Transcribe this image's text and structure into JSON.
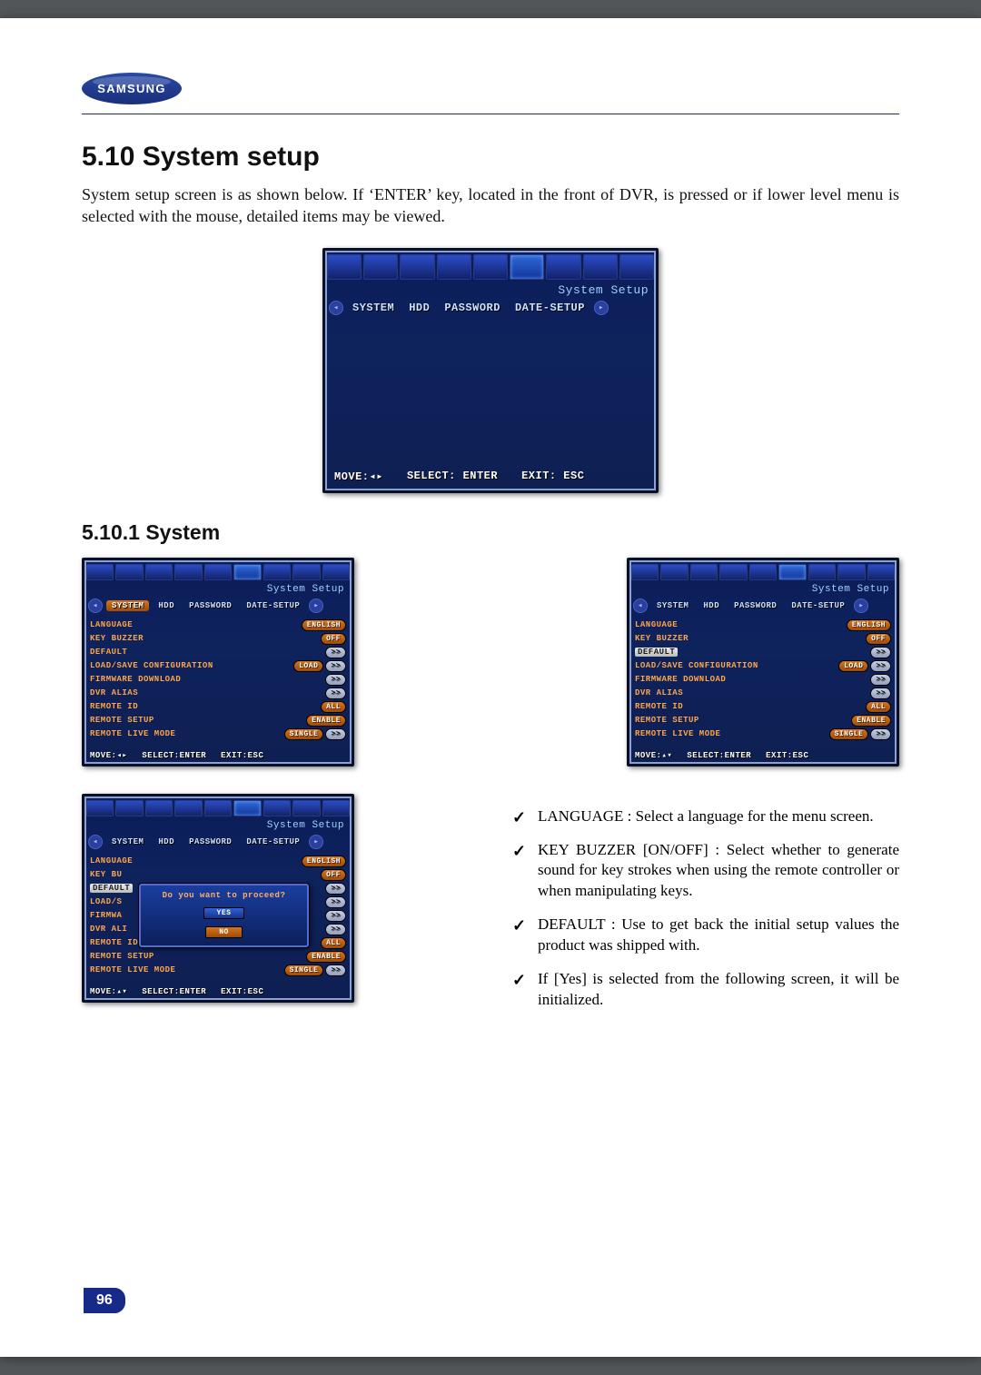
{
  "logo_text": "SAMSUNG",
  "section_heading": "5.10 System setup",
  "section_intro": "System setup screen is as shown below. If ‘ENTER’ key, located in the front of DVR, is pressed or if lower level menu is selected with the mouse, detailed items may be viewed.",
  "subsection_heading": "5.10.1 System",
  "page_number": "96",
  "screen_title": "System Setup",
  "tabs": [
    "SYSTEM",
    "HDD",
    "PASSWORD",
    "DATE-SETUP"
  ],
  "footer_move_lr": "MOVE:◂▸",
  "footer_move_ud": "MOVE:▴▾",
  "footer_select": "SELECT: ENTER",
  "footer_select_tight": "SELECT:ENTER",
  "footer_exit": "EXIT: ESC",
  "footer_exit_tight": "EXIT:ESC",
  "rows": {
    "language": {
      "label": "LANGUAGE",
      "value": "ENGLISH"
    },
    "key_buzzer": {
      "label": "KEY BUZZER",
      "value": "OFF"
    },
    "default": {
      "label": "DEFAULT",
      "value": ">>"
    },
    "load_save": {
      "label": "LOAD/SAVE CONFIGURATION",
      "value": "LOAD",
      "arrow": ">>"
    },
    "firmware": {
      "label": "FIRMWARE DOWNLOAD",
      "value": ">>"
    },
    "dvr_alias": {
      "label": "DVR ALIAS",
      "value": ">>"
    },
    "remote_id": {
      "label": "REMOTE ID",
      "value": "ALL"
    },
    "remote_setup": {
      "label": "REMOTE SETUP",
      "value": "ENABLE"
    },
    "remote_live": {
      "label": "REMOTE LIVE MODE",
      "value": "SINGLE",
      "arrow": ">>"
    }
  },
  "dialog_prompt": "Do you want to proceed?",
  "dialog_yes": "YES",
  "dialog_no": "NO",
  "trunc": {
    "load_s": "LOAD/S",
    "firmwa": "FIRMWA",
    "dvr_al": "DVR ALI",
    "key_bu": "KEY BU"
  },
  "bullets": [
    "LANGUAGE : Select a language for the menu screen.",
    "KEY BUZZER [ON/OFF] : Select whether to generate sound for key strokes when using the remote controller or when manipulating keys.",
    "DEFAULT : Use to get back the initial setup values the product was shipped with.",
    "If [Yes] is selected from the following screen, it will be initialized."
  ]
}
